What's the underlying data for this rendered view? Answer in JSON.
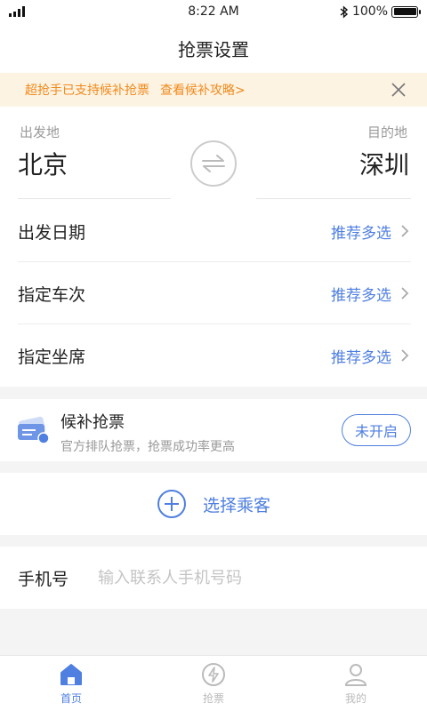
{
  "status": {
    "time": "8:22 AM",
    "battery": "100%"
  },
  "nav": {
    "title": "抢票设置"
  },
  "notice": {
    "text": "超抢手已支持候补抢票",
    "link": "查看候补攻略>"
  },
  "route": {
    "from_label": "出发地",
    "from_city": "北京",
    "to_label": "目的地",
    "to_city": "深圳"
  },
  "options": [
    {
      "label": "出发日期",
      "value": "推荐多选"
    },
    {
      "label": "指定车次",
      "value": "推荐多选"
    },
    {
      "label": "指定坐席",
      "value": "推荐多选"
    }
  ],
  "waitlist": {
    "title": "候补抢票",
    "subtitle": "官方排队抢票，抢票成功率更高",
    "button": "未开启"
  },
  "passenger": {
    "label": "选择乘客"
  },
  "phone": {
    "label": "手机号",
    "placeholder": "输入联系人手机号码",
    "value": ""
  },
  "tabs": [
    {
      "label": "首页"
    },
    {
      "label": "抢票"
    },
    {
      "label": "我的"
    }
  ],
  "colors": {
    "accent": "#4f7fe0",
    "notice_bg": "#fdf3e3",
    "notice_text": "#f08a1c"
  }
}
